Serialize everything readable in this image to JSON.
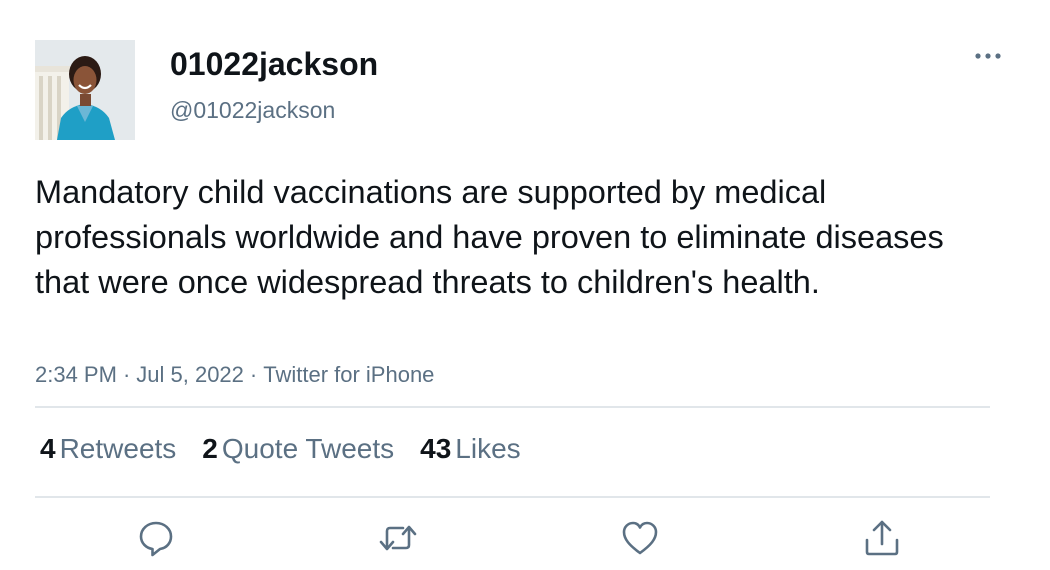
{
  "user": {
    "display_name": "01022jackson",
    "handle": "@01022jackson"
  },
  "tweet": {
    "text": "Mandatory child vaccinations are supported by medical professionals worldwide and have proven to eliminate diseases that were once widespread threats to children's health.",
    "time": "2:34 PM",
    "date": "Jul 5, 2022",
    "source": "Twitter for iPhone",
    "separator": "·"
  },
  "stats": {
    "retweets": {
      "count": "4",
      "label": "Retweets"
    },
    "quotes": {
      "count": "2",
      "label": "Quote Tweets"
    },
    "likes": {
      "count": "43",
      "label": "Likes"
    }
  },
  "icons": {
    "more": "more-dots-icon",
    "reply": "reply-icon",
    "retweet": "retweet-icon",
    "like": "heart-icon",
    "share": "share-icon"
  },
  "colors": {
    "text": "#0f1419",
    "secondary": "#5b7083",
    "divider": "#e1e6ea"
  }
}
